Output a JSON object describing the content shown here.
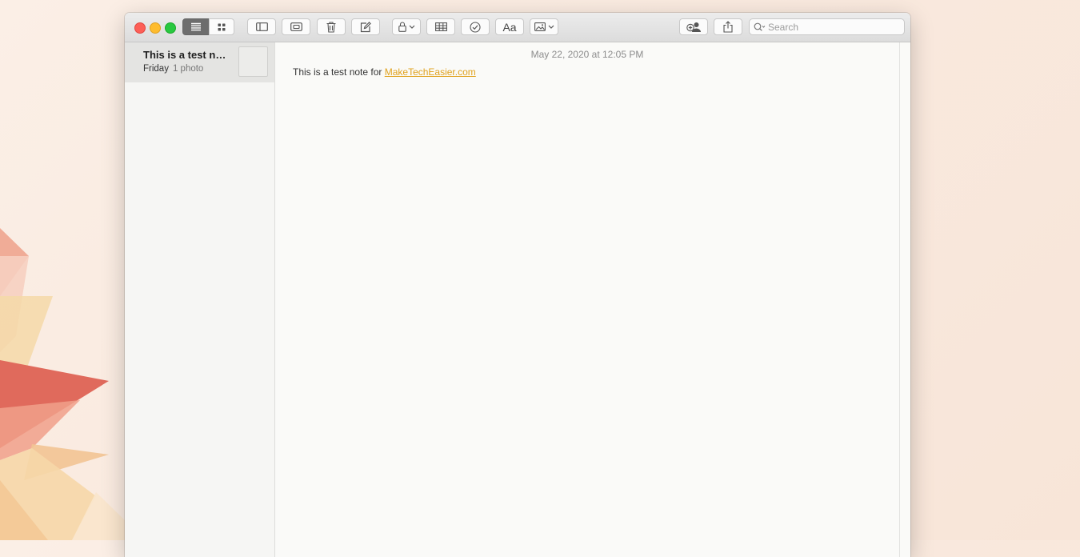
{
  "toolbar": {
    "view_list_icon": "list-icon",
    "view_gallery_icon": "grid-icon",
    "search_placeholder": "Search",
    "format_button_label": "Aa"
  },
  "sidebar": {
    "notes": [
      {
        "title": "This is a test note for MakeTechEasier.com",
        "date": "Friday",
        "meta": "1 photo",
        "selected": true
      }
    ]
  },
  "editor": {
    "date_line": "May 22, 2020 at 12:05 PM",
    "body_text": "This is a test note for ",
    "link_text": "MakeTechEasier.com"
  },
  "colors": {
    "link": "#e0a21e",
    "close": "#fd5f57",
    "minimize": "#febc2e",
    "maximize": "#28c840"
  }
}
